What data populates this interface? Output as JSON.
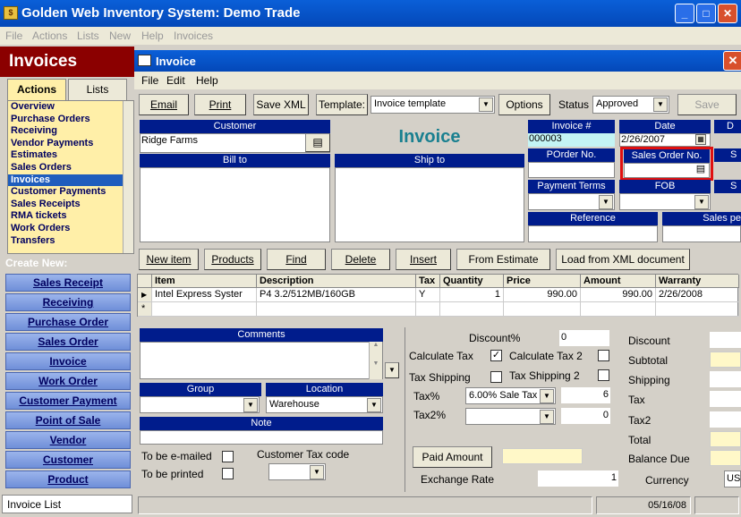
{
  "app": {
    "title": "Golden Web Inventory System: Demo Trade",
    "icon": "app-logo-icon",
    "menu": [
      "File",
      "Actions",
      "Lists",
      "New",
      "Help",
      "Invoices"
    ]
  },
  "left": {
    "header": "Invoices",
    "tabs": [
      "Actions",
      "Lists"
    ],
    "nav": [
      "Overview",
      "Purchase Orders",
      "Receiving",
      "Vendor Payments",
      "Estimates",
      "Sales Orders",
      "Invoices",
      "Customer Payments",
      "Sales Receipts",
      "RMA tickets",
      "Work Orders",
      "Transfers"
    ],
    "selected": "Invoices",
    "create_new_label": "Create New:",
    "create_buttons": [
      "Sales Receipt",
      "Receiving",
      "Purchase Order",
      "Sales Order",
      "Invoice",
      "Work Order",
      "Customer Payment",
      "Point of Sale",
      "Vendor",
      "Customer",
      "Product"
    ],
    "status": "Invoice List"
  },
  "invoice": {
    "title": "Invoice",
    "menu": [
      "File",
      "Edit",
      "Help"
    ],
    "toolbar": {
      "email": "Email",
      "print": "Print",
      "save_xml": "Save XML",
      "template_label": "Template:",
      "template_value": "Invoice template",
      "options": "Options",
      "status_label": "Status",
      "status_value": "Approved",
      "save": "Save"
    },
    "heading": "Invoice",
    "customer_label": "Customer",
    "customer_value": "Ridge Farms",
    "bill_to_label": "Bill to",
    "ship_to_label": "Ship to",
    "invoice_no_label": "Invoice #",
    "invoice_no": "000003",
    "date_label": "Date",
    "date_value": "2/26/2007",
    "porder_label": "POrder No.",
    "sales_order_label": "Sales Order No.",
    "payment_terms_label": "Payment Terms",
    "fob_label": "FOB",
    "reference_label": "Reference",
    "sales_person_label": "Sales pe",
    "cut_labels": [
      "D",
      "S",
      "S"
    ],
    "item_buttons": {
      "new_item": "New item",
      "products": "Products",
      "find": "Find",
      "delete": "Delete",
      "insert": "Insert",
      "from_estimate": "From Estimate",
      "load_xml": "Load from XML document"
    },
    "columns": [
      "Item",
      "Description",
      "Tax",
      "Quantity",
      "Price",
      "Amount",
      "Warranty"
    ],
    "rows": [
      {
        "item": "Intel Express Syster",
        "description": "P4 3.2/512MB/160GB",
        "tax": "Y",
        "quantity": "1",
        "price": "990.00",
        "amount": "990.00",
        "warranty": "2/26/2008"
      }
    ],
    "new_row_marker": "*",
    "comments_label": "Comments",
    "group_label": "Group",
    "location_label": "Location",
    "location_value": "Warehouse",
    "note_label": "Note",
    "to_be_emailed": "To be e-mailed",
    "to_be_printed": "To be printed",
    "customer_tax_code": "Customer Tax code",
    "discount_label": "Discount%",
    "discount_value": "0",
    "calc_tax": "Calculate Tax",
    "calc_tax_checked": "✓",
    "calc_tax2": "Calculate Tax 2",
    "tax_shipping": "Tax Shipping",
    "tax_shipping2": "Tax Shipping 2",
    "tax_pct_label": "Tax%",
    "tax_pct_select": "6.00% Sale Tax",
    "tax_pct_value": "6",
    "tax2_label": "Tax2%",
    "tax2_value": "0",
    "paid_amount": "Paid Amount",
    "exchange_rate_label": "Exchange Rate",
    "exchange_rate": "1",
    "totals": [
      "Discount",
      "Subtotal",
      "Shipping",
      "Tax",
      "Tax2",
      "Total",
      "Balance Due"
    ],
    "currency_label": "Currency",
    "currency_value": "US",
    "status_date": "05/16/08"
  }
}
